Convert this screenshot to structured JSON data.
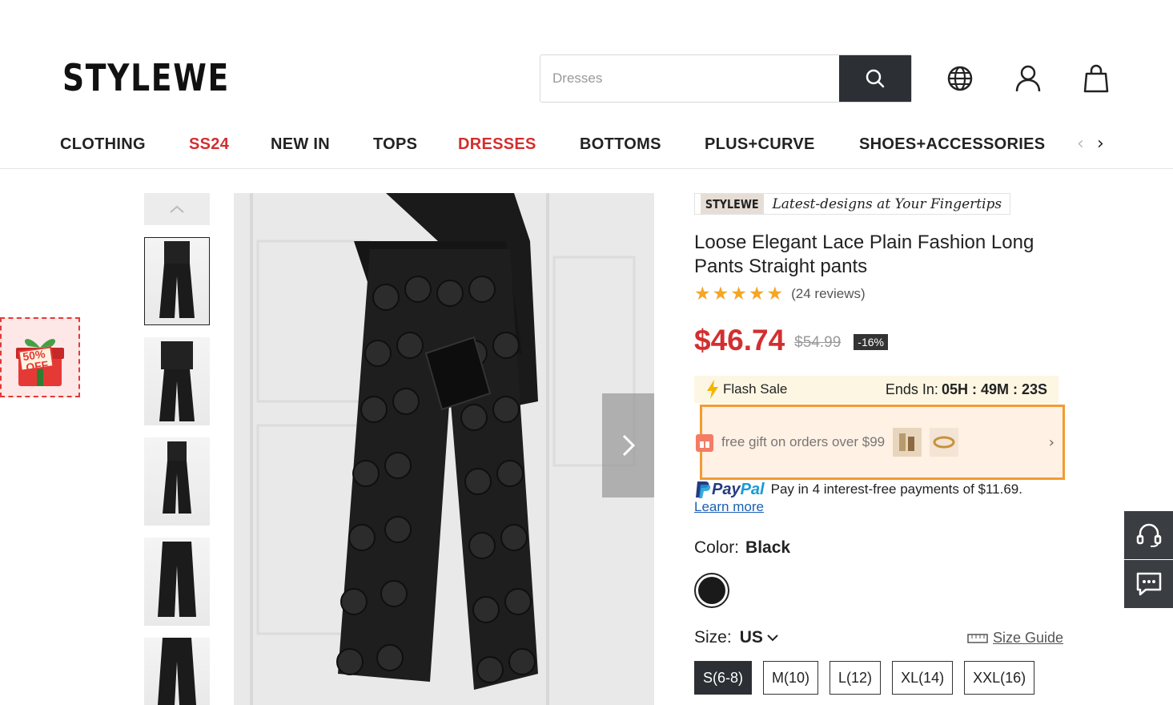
{
  "header": {
    "logo": "STYLEWE",
    "search_placeholder": "Dresses",
    "icons": [
      "search-icon",
      "globe-icon",
      "user-icon",
      "bag-icon"
    ]
  },
  "nav": {
    "items": [
      {
        "label": "CLOTHING",
        "color": "#222222"
      },
      {
        "label": "SS24",
        "color": "#d32f2f"
      },
      {
        "label": "NEW IN",
        "color": "#222222"
      },
      {
        "label": "TOPS",
        "color": "#222222"
      },
      {
        "label": "DRESSES",
        "color": "#d32f2f"
      },
      {
        "label": "BOTTOMS",
        "color": "#222222"
      },
      {
        "label": "PLUS+CURVE",
        "color": "#222222"
      },
      {
        "label": "SHOES+ACCESSORIES",
        "color": "#222222"
      }
    ],
    "prev": "‹",
    "next": "›"
  },
  "promo": {
    "text_top": "50%",
    "text_bottom": "OFF"
  },
  "product": {
    "slogan_brand": "STYLEWE",
    "slogan_text": "Latest-designs at Your Fingertips",
    "title": "Loose Elegant Lace Plain Fashion Long Pants Straight pants",
    "stars": "★★★★★",
    "reviews": "(24 reviews)",
    "price": "$46.74",
    "original_price": "$54.99",
    "discount": "-16%",
    "flash_label": "Flash Sale",
    "ends_label": "Ends In:",
    "timer": "05H : 49M : 23S",
    "gift_text": "free gift on orders over $99",
    "paypal_logo_a": "Pay",
    "paypal_logo_b": "Pal",
    "paypal_text": "Pay in 4 interest-free payments of $11.69.",
    "learn_more": "Learn more",
    "color_label": "Color:",
    "color_value": "Black",
    "size_label": "Size:",
    "size_region": "US",
    "size_guide": "Size Guide",
    "sizes": [
      "S(6-8)",
      "M(10)",
      "L(12)",
      "XL(14)",
      "XXL(16)"
    ],
    "selected_size": "S(6-8)"
  },
  "accent": "#d32f2f"
}
